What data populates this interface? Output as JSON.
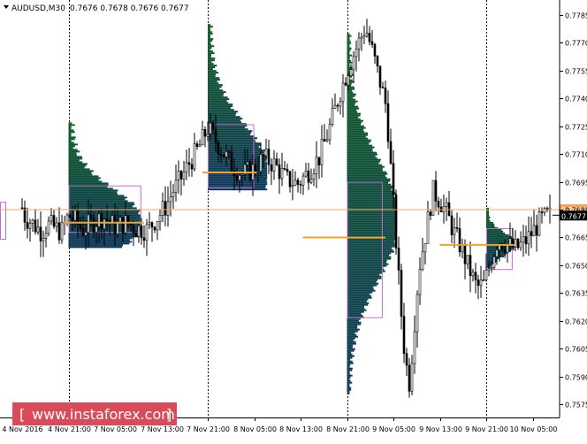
{
  "header": {
    "symbol_label": "AUDUSD,M30",
    "ohlc": "0.7676 0.7678 0.7676 0.7677"
  },
  "watermark": {
    "text": "www.instaforex.com",
    "bracket_open": "[",
    "bracket_close": "]",
    "color": "#d94a5a"
  },
  "price_tags": {
    "reference": {
      "label": "0.7680",
      "color": "#f4a460"
    },
    "current": {
      "label": "0.7677",
      "color": "#000000"
    }
  },
  "colors": {
    "background": "#ffffff",
    "candle": "#000000",
    "profile_green": "#0f6b0f",
    "profile_navy": "#0d2a6e",
    "value_area_box": "#c070d0",
    "poc_line": "#f2a22e",
    "reference_line": "#f4a460",
    "grid": "#000000"
  },
  "chart_data": {
    "type": "candlestick",
    "symbol": "AUDUSD",
    "timeframe": "M30",
    "ylim": [
      0.7568,
      0.7792
    ],
    "y_ticks": [
      "0.7785",
      "0.7770",
      "0.7755",
      "0.7740",
      "0.7725",
      "0.7710",
      "0.7695",
      "0.7680",
      "0.7665",
      "0.7650",
      "0.7635",
      "0.7620",
      "0.7605",
      "0.7590",
      "0.7575"
    ],
    "x_ticks": [
      "4 Nov 2016",
      "4 Nov 21:00",
      "7 Nov 05:00",
      "7 Nov 13:00",
      "7 Nov 21:00",
      "8 Nov 05:00",
      "8 Nov 13:00",
      "8 Nov 21:00",
      "9 Nov 05:00",
      "9 Nov 13:00",
      "9 Nov 21:00",
      "10 Nov 05:00"
    ],
    "x_tick_index": [
      0,
      1,
      2,
      3,
      4,
      5,
      6,
      7,
      8,
      9,
      10,
      11
    ],
    "session_dividers_at_tick": [
      1,
      4,
      7,
      10
    ],
    "reference_price": 0.768,
    "current_price": 0.7677,
    "price_path": [
      [
        0.0,
        0.7681
      ],
      [
        0.06,
        0.7676
      ],
      [
        0.25,
        0.7672
      ],
      [
        0.42,
        0.7668
      ],
      [
        0.55,
        0.7672
      ],
      [
        0.72,
        0.767
      ],
      [
        0.85,
        0.7668
      ],
      [
        1.0,
        0.7677
      ],
      [
        1.15,
        0.7674
      ],
      [
        1.3,
        0.7669
      ],
      [
        1.5,
        0.7673
      ],
      [
        1.75,
        0.7676
      ],
      [
        2.0,
        0.7671
      ],
      [
        2.25,
        0.7673
      ],
      [
        2.45,
        0.767
      ],
      [
        2.7,
        0.7669
      ],
      [
        2.95,
        0.7677
      ],
      [
        3.1,
        0.7682
      ],
      [
        3.25,
        0.769
      ],
      [
        3.45,
        0.7698
      ],
      [
        3.6,
        0.7705
      ],
      [
        3.8,
        0.7713
      ],
      [
        4.0,
        0.7724
      ],
      [
        4.15,
        0.7718
      ],
      [
        4.3,
        0.7712
      ],
      [
        4.55,
        0.7703
      ],
      [
        4.75,
        0.7699
      ],
      [
        5.0,
        0.7702
      ],
      [
        5.2,
        0.7708
      ],
      [
        5.45,
        0.7704
      ],
      [
        5.7,
        0.7696
      ],
      [
        5.95,
        0.7694
      ],
      [
        6.15,
        0.77
      ],
      [
        6.4,
        0.7708
      ],
      [
        6.6,
        0.7722
      ],
      [
        6.85,
        0.7743
      ],
      [
        7.05,
        0.7758
      ],
      [
        7.25,
        0.777
      ],
      [
        7.4,
        0.7778
      ],
      [
        7.55,
        0.7765
      ],
      [
        7.7,
        0.775
      ],
      [
        7.85,
        0.7735
      ],
      [
        7.95,
        0.77
      ],
      [
        8.05,
        0.7665
      ],
      [
        8.15,
        0.763
      ],
      [
        8.25,
        0.76
      ],
      [
        8.35,
        0.7586
      ],
      [
        8.45,
        0.7618
      ],
      [
        8.55,
        0.7648
      ],
      [
        8.7,
        0.7668
      ],
      [
        8.85,
        0.769
      ],
      [
        9.0,
        0.7685
      ],
      [
        9.15,
        0.7678
      ],
      [
        9.3,
        0.7668
      ],
      [
        9.45,
        0.766
      ],
      [
        9.6,
        0.765
      ],
      [
        9.8,
        0.7638
      ],
      [
        9.95,
        0.764
      ],
      [
        10.1,
        0.7652
      ],
      [
        10.25,
        0.7664
      ],
      [
        10.45,
        0.7661
      ],
      [
        10.65,
        0.7659
      ],
      [
        10.85,
        0.7663
      ],
      [
        11.0,
        0.7668
      ],
      [
        11.2,
        0.7675
      ],
      [
        11.4,
        0.7677
      ]
    ],
    "profiles": [
      {
        "name": "4 Nov",
        "start_tick": 1.0,
        "price_range": [
          0.7659,
          0.7727
        ],
        "peak_price": 0.7674,
        "peak_width_ticks": 1.55,
        "poc": 0.7673,
        "value_area": [
          0.7668,
          0.7693
        ],
        "box_end_tick": 2.55
      },
      {
        "name": "7 Nov",
        "start_tick": 4.0,
        "price_range": [
          0.769,
          0.778
        ],
        "peak_price": 0.77,
        "peak_width_ticks": 1.28,
        "poc": 0.77,
        "value_area": [
          0.7692,
          0.7726
        ],
        "box_end_tick": 4.98
      },
      {
        "name": "8 Nov",
        "start_tick": 7.0,
        "price_range": [
          0.758,
          0.7775
        ],
        "peak_price": 0.7675,
        "peak_width_ticks": 1.08,
        "poc": 0.7665,
        "value_area": [
          0.7622,
          0.7695
        ],
        "box_end_tick": 7.75,
        "poc_line_start_tick": 6.05
      },
      {
        "name": "9 Nov",
        "start_tick": 10.0,
        "price_range": [
          0.7648,
          0.7681
        ],
        "peak_price": 0.7662,
        "peak_width_ticks": 0.62,
        "poc": 0.7661,
        "value_area": [
          0.7648,
          0.767
        ],
        "box_end_tick": 10.55,
        "poc_line_start_tick": 9.0
      }
    ]
  }
}
